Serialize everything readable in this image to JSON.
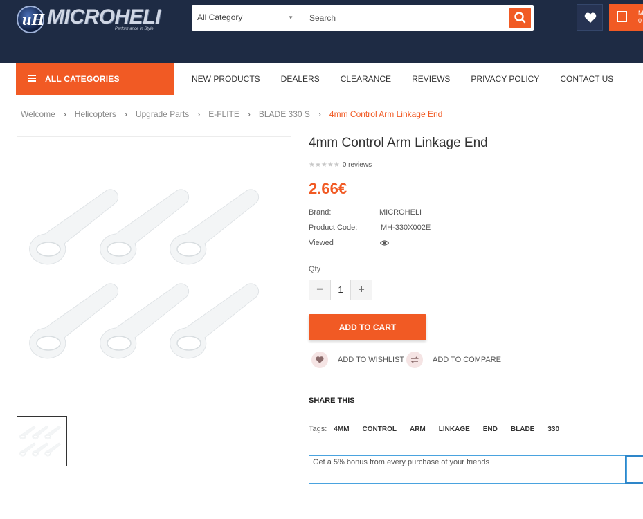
{
  "header": {
    "logo_text": "MICROHELI",
    "logo_mark": "uH",
    "logo_tagline": "Performance in Style",
    "category_select": "All Category",
    "search_placeholder": "Search",
    "cart_partial_line1": "M",
    "cart_partial_line2": "0"
  },
  "nav": {
    "all_categories": "ALL CATEGORIES",
    "links": [
      "NEW PRODUCTS",
      "DEALERS",
      "CLEARANCE",
      "REVIEWS",
      "PRIVACY POLICY",
      "CONTACT US"
    ]
  },
  "breadcrumb": [
    "Welcome",
    "Helicopters",
    "Upgrade Parts",
    "E-FLITE",
    "BLADE 330 S",
    "4mm Control Arm Linkage End"
  ],
  "breadcrumb_sep": "›",
  "product": {
    "title": "4mm Control Arm Linkage End",
    "stars": "★★★★★",
    "rating": 0,
    "reviews": "0 reviews",
    "price": "2.66€",
    "brand_label": "Brand:",
    "brand_value": "MICROHELI",
    "code_label": "Product Code:",
    "code_value": "MH-330X002E",
    "viewed_label": "Viewed",
    "qty_label": "Qty",
    "qty_value": "1",
    "qty_minus": "−",
    "qty_plus": "+",
    "add_to_cart": "ADD TO CART",
    "add_to_wishlist": "ADD TO WISHLIST",
    "add_to_compare": "ADD TO COMPARE",
    "share_this": "SHARE THIS",
    "tags_label": "Tags:",
    "tags": [
      "4MM",
      "CONTROL",
      "ARM",
      "LINKAGE",
      "END",
      "BLADE",
      "330"
    ],
    "bonus_text": "Get a 5% bonus from every purchase of your friends"
  },
  "colors": {
    "accent": "#f15a24",
    "header_bg": "#1e2b44"
  },
  "icons": {
    "search": "search-icon",
    "wishlist": "heart-icon",
    "cart": "cart-icon",
    "viewed": "eye-icon",
    "compare": "compare-icon",
    "menu": "hamburger-icon"
  }
}
